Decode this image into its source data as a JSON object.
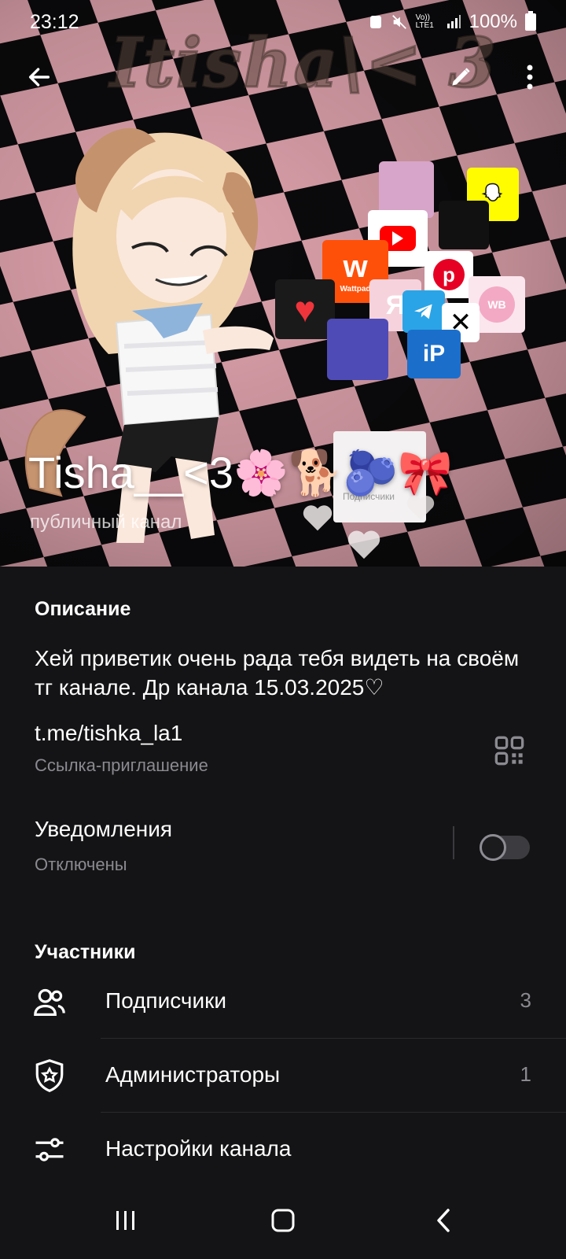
{
  "status_bar": {
    "time": "23:12",
    "network_label": "Vo)) LTE1",
    "battery": "100%"
  },
  "header": {
    "watermark": "Itisha\\< 3",
    "channel_title": "Tisha__<3🌸🐕🫐🎀",
    "channel_type": "публичный канал",
    "sticker_text": "Подписчики",
    "app_icons": [
      "youtube-icon",
      "snapchat-icon",
      "wattpad-icon",
      "pinterest-icon",
      "telegram-icon",
      "ibis-paint-icon",
      "capcut-icon",
      "wb-icon",
      "yandex-icon",
      "likee-icon"
    ],
    "wattpad_label": "Wattpad",
    "yandex_label": "Я",
    "wb_label": "WB",
    "ip_label": "iP"
  },
  "description": {
    "label": "Описание",
    "text": "Хей приветик очень рада тебя видеть на своём тг канале. Др канала 15.03.2025♡"
  },
  "link": {
    "url": "t.me/tishka_la1",
    "caption": "Ссылка-приглашение"
  },
  "notifications": {
    "title": "Уведомления",
    "status": "Отключены",
    "enabled": false
  },
  "members": {
    "label": "Участники",
    "items": [
      {
        "label": "Подписчики",
        "count": "3",
        "icon": "users-icon"
      },
      {
        "label": "Администраторы",
        "count": "1",
        "icon": "shield-star-icon"
      },
      {
        "label": "Настройки канала",
        "count": "",
        "icon": "sliders-icon"
      }
    ]
  },
  "colors": {
    "background": "#141416",
    "checker_pink": "#e9aab4",
    "muted_text": "#8a8a90"
  }
}
